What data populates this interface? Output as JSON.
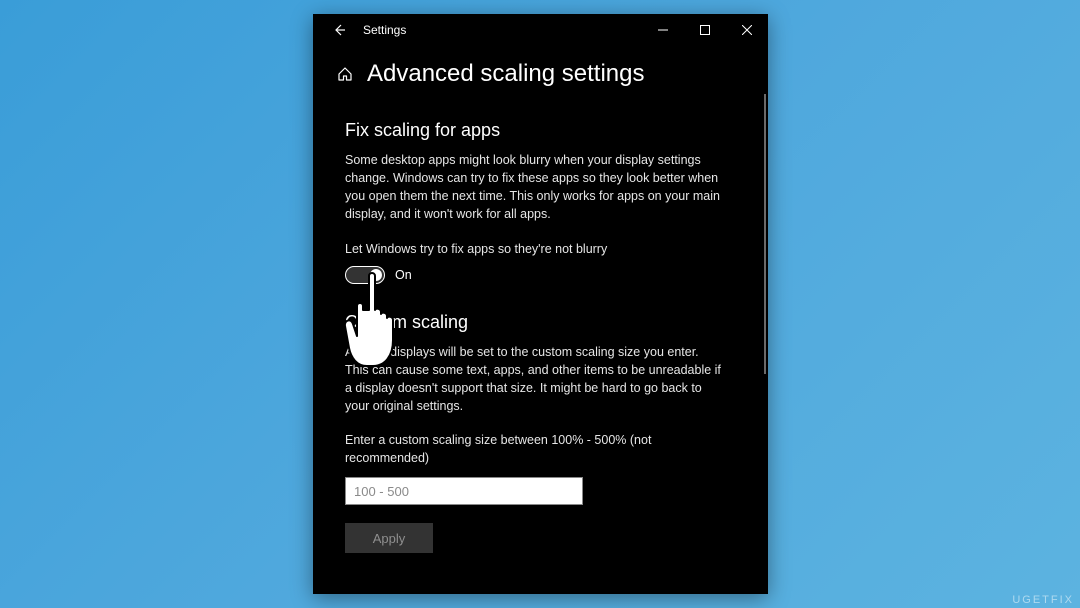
{
  "titlebar": {
    "app_title": "Settings"
  },
  "header": {
    "page_title": "Advanced scaling settings"
  },
  "section1": {
    "title": "Fix scaling for apps",
    "desc": "Some desktop apps might look blurry when your display settings change. Windows can try to fix these apps so they look better when you open them the next time. This only works for apps on your main display, and it won't work for all apps.",
    "toggle_label": "Let Windows try to fix apps so they're not blurry",
    "toggle_state": "On"
  },
  "section2": {
    "title": "Custom scaling",
    "desc": "All your displays will be set to the custom scaling size you enter. This can cause some text, apps, and other items to be unreadable if a display doesn't support that size. It might be hard to go back to your original settings.",
    "input_label": "Enter a custom scaling size between 100% - 500% (not recommended)",
    "input_placeholder": "100 - 500",
    "apply_label": "Apply"
  },
  "watermark": "UGETFIX"
}
